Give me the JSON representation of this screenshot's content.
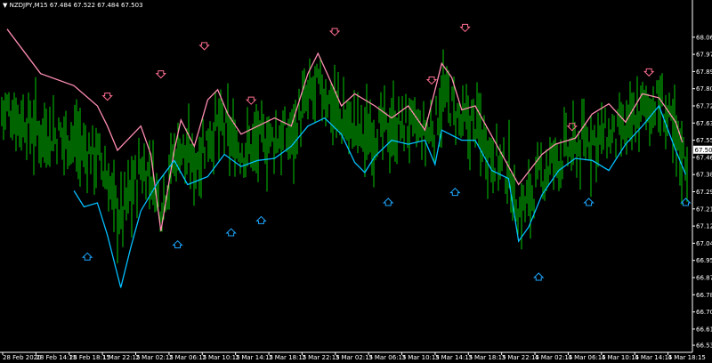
{
  "header": {
    "menu_icon": "triangle-down-icon",
    "symbol": "NZDJPY,M15",
    "ohlc": "67.484 67.522 67.484 67.503"
  },
  "colors": {
    "background": "#000000",
    "candles": "#00c800",
    "line_upper": "#ff8db0",
    "line_lower": "#00bfff",
    "arrow_down": "#ff6f91",
    "arrow_up": "#1ea7ff",
    "axis": "#ffffff",
    "current_price_box": "#ffffff"
  },
  "chart_data": {
    "type": "line",
    "title": "",
    "xlabel": "",
    "ylabel": "",
    "ylim": [
      66.5,
      68.2
    ],
    "y_ticks": [
      "68.060",
      "67.975",
      "67.890",
      "67.805",
      "67.720",
      "67.635",
      "67.550",
      "67.465",
      "67.380",
      "67.295",
      "67.210",
      "67.125",
      "67.040",
      "66.955",
      "66.870",
      "66.785",
      "66.700",
      "66.615",
      "66.535"
    ],
    "x_ticks": [
      "28 Feb 2020",
      "28 Feb 14:15",
      "28 Feb 18:15",
      "1 Mar 22:15",
      "2 Mar 02:15",
      "2 Mar 06:15",
      "2 Mar 10:15",
      "2 Mar 14:15",
      "2 Mar 18:15",
      "2 Mar 22:15",
      "3 Mar 02:15",
      "3 Mar 06:15",
      "3 Mar 10:15",
      "3 Mar 14:15",
      "3 Mar 18:15",
      "3 Mar 22:15",
      "4 Mar 02:15",
      "4 Mar 06:15",
      "4 Mar 10:15",
      "4 Mar 14:15",
      "4 Mar 18:15"
    ],
    "current_price": "67.503",
    "series_upper_x": [
      0,
      1,
      2,
      2.7,
      3,
      3.3,
      4,
      4.3,
      4.6,
      5,
      5.2,
      5.6,
      6,
      6.3,
      6.6,
      7,
      8,
      8.5,
      9,
      9.3,
      9.6,
      10,
      10.4,
      11,
      11.5,
      12,
      12.5,
      13,
      13.3,
      13.6,
      14,
      15,
      15.3,
      16,
      16.4,
      17,
      17.5,
      18,
      18.5,
      19,
      19.5,
      20,
      20.2
    ],
    "series_upper_y": [
      68.1,
      67.88,
      67.82,
      67.72,
      67.62,
      67.5,
      67.62,
      67.48,
      67.1,
      67.5,
      67.65,
      67.52,
      67.75,
      67.8,
      67.68,
      67.58,
      67.66,
      67.62,
      67.88,
      67.98,
      67.87,
      67.72,
      67.78,
      67.72,
      67.66,
      67.72,
      67.6,
      67.93,
      67.86,
      67.7,
      67.72,
      67.42,
      67.33,
      67.48,
      67.53,
      67.56,
      67.68,
      67.73,
      67.64,
      67.78,
      67.76,
      67.64,
      67.54
    ],
    "series_lower_x": [
      2,
      2.3,
      2.7,
      3,
      3.4,
      3.7,
      4,
      4.5,
      5,
      5.4,
      6,
      6.5,
      7,
      7.5,
      8,
      8.5,
      9,
      9.5,
      10,
      10.4,
      10.7,
      11,
      11.5,
      12,
      12.5,
      12.8,
      13,
      13.6,
      14,
      14.5,
      15,
      15.3,
      15.6,
      16,
      16.5,
      17,
      17.5,
      18,
      18.5,
      19,
      19.5,
      20,
      20.3
    ],
    "series_lower_y": [
      67.3,
      67.22,
      67.24,
      67.08,
      66.82,
      67.02,
      67.2,
      67.34,
      67.45,
      67.33,
      67.37,
      67.48,
      67.42,
      67.45,
      67.46,
      67.52,
      67.62,
      67.66,
      67.58,
      67.44,
      67.39,
      67.47,
      67.55,
      67.53,
      67.55,
      67.43,
      67.6,
      67.55,
      67.55,
      67.4,
      67.36,
      67.05,
      67.12,
      67.28,
      67.4,
      67.46,
      67.45,
      67.4,
      67.53,
      67.62,
      67.72,
      67.5,
      67.38
    ],
    "arrows_down": [
      {
        "x": 3.0,
        "y": 67.77
      },
      {
        "x": 4.6,
        "y": 67.88
      },
      {
        "x": 5.9,
        "y": 68.02
      },
      {
        "x": 7.3,
        "y": 67.75
      },
      {
        "x": 9.8,
        "y": 68.09
      },
      {
        "x": 12.7,
        "y": 67.85
      },
      {
        "x": 13.7,
        "y": 68.11
      },
      {
        "x": 16.9,
        "y": 67.62
      },
      {
        "x": 19.2,
        "y": 67.89
      }
    ],
    "arrows_up": [
      {
        "x": 2.4,
        "y": 66.97
      },
      {
        "x": 5.1,
        "y": 67.03
      },
      {
        "x": 6.7,
        "y": 67.09
      },
      {
        "x": 7.6,
        "y": 67.15
      },
      {
        "x": 11.4,
        "y": 67.24
      },
      {
        "x": 13.4,
        "y": 67.29
      },
      {
        "x": 15.9,
        "y": 66.87
      },
      {
        "x": 17.4,
        "y": 67.24
      },
      {
        "x": 20.3,
        "y": 67.24
      }
    ]
  }
}
